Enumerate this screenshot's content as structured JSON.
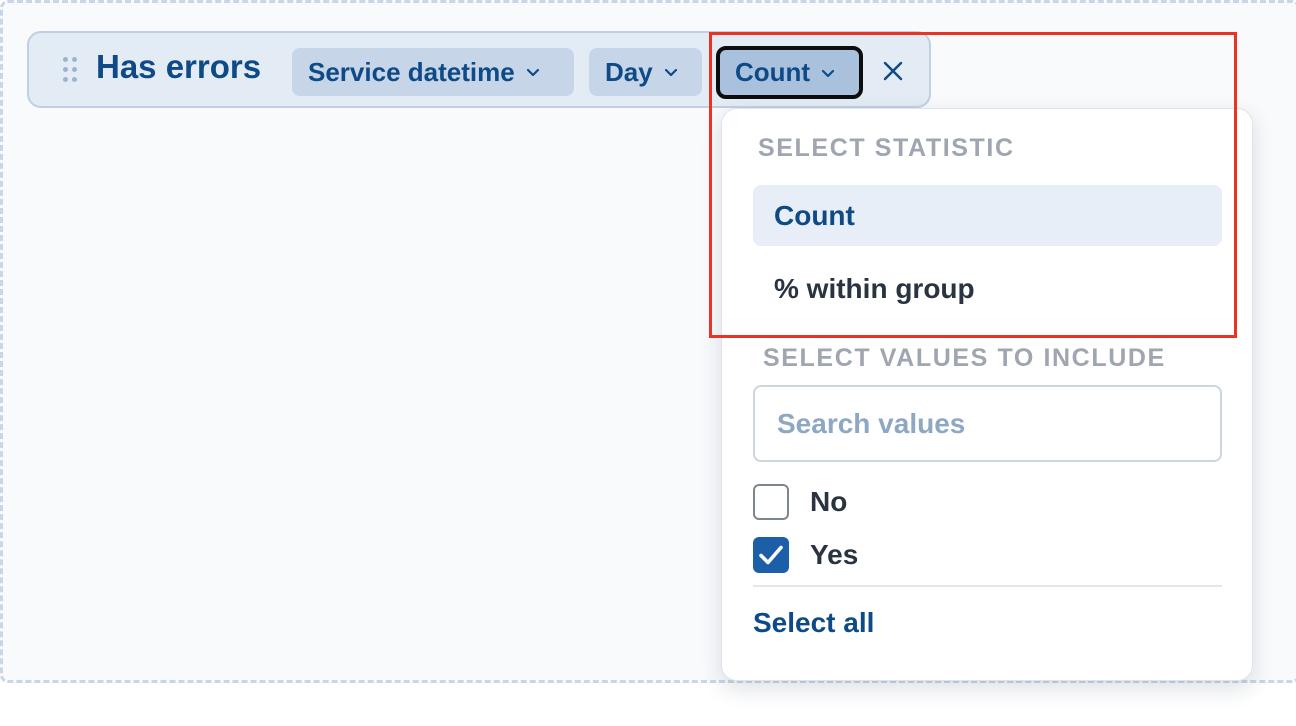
{
  "group_pill": {
    "title": "Has errors",
    "chips": {
      "service": "Service datetime",
      "interval": "Day",
      "statistic": "Count"
    }
  },
  "popover": {
    "statistic_section": {
      "label": "SELECT STATISTIC",
      "options": [
        "Count",
        "% within group"
      ],
      "selected": "Count"
    },
    "values_section": {
      "label": "SELECT VALUES TO INCLUDE",
      "search_placeholder": "Search values",
      "search_value": "",
      "items": [
        {
          "label": "No",
          "checked": false
        },
        {
          "label": "Yes",
          "checked": true
        }
      ],
      "select_all_label": "Select all"
    }
  },
  "icons": {
    "drag_handle": "drag-handle-icon",
    "chevron": "chevron-down-icon",
    "close": "close-icon",
    "check": "checkmark-icon"
  },
  "colors": {
    "accent": "#0e4a86",
    "chip_bg": "#c6d6e8",
    "active_chip_bg": "#a9c1dd",
    "checkbox_checked": "#1c5fa8",
    "highlight_annotation": "#ea3323",
    "muted_label": "#9fa6b2"
  }
}
